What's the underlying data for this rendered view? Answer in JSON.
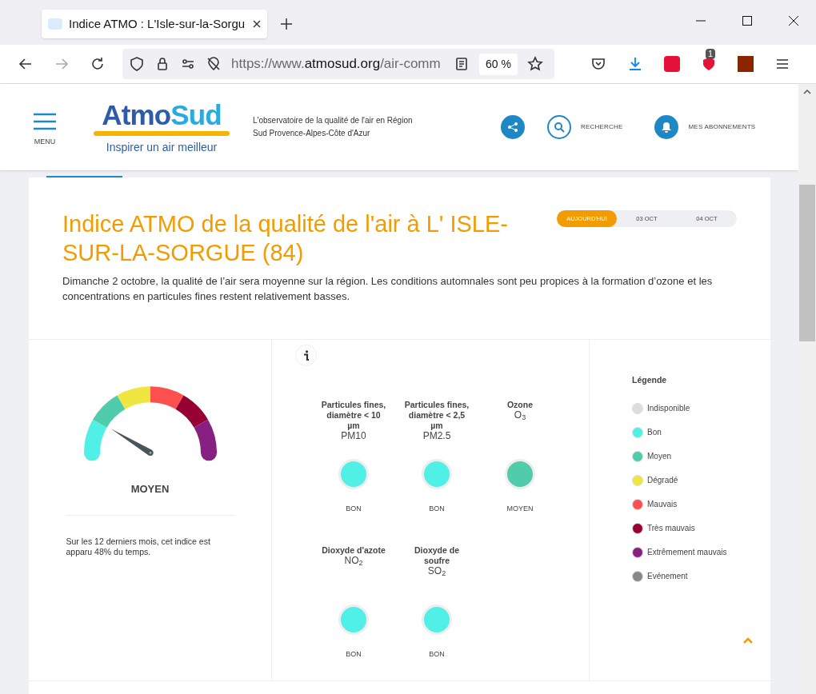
{
  "browser": {
    "tab_title": "Indice ATMO : L'Isle-sur-la-Sorgu",
    "url_prefix": "https://www.",
    "url_domain": "atmosud.org",
    "url_path": "/air-comm",
    "zoom": "60 %",
    "extension_badge": "1"
  },
  "header": {
    "menu_label": "MENU",
    "logo_title_1": "Atmo",
    "logo_title_2": "Sud",
    "logo_tagline": "Inspirer un air meilleur",
    "description": "L'observatoire de la qualité de l'air en Région Sud Provence-Alpes-Côte d'Azur",
    "search_label": "RECHERCHE",
    "subscriptions_label": "MES ABONNEMENTS"
  },
  "title": "Indice ATMO de la qualité de l'air à L' ISLE-SUR-LA-SORGUE (84)",
  "date_tabs": [
    {
      "label": "AUJOURD'HUI",
      "selected": true
    },
    {
      "label": "03 OCT",
      "selected": false
    },
    {
      "label": "04 OCT",
      "selected": false
    }
  ],
  "summary": "Dimanche 2 octobre, la qualité de l’air sera moyenne sur la région. Les conditions automnales sont peu propices à la formation d’ozone et les concentrations en particules fines restent relativement basses.",
  "gauge": {
    "label": "MOYEN",
    "note": "Sur les 12 derniers mois, cet indice est apparu 48% du temps."
  },
  "pollutants": [
    {
      "name": "Particules fines, diamètre < 10 µm",
      "formula": "PM10",
      "status": "BON",
      "color": "#50f0e6"
    },
    {
      "name": "Particules fines, diamètre < 2,5 µm",
      "formula": "PM2.5",
      "status": "BON",
      "color": "#50f0e6"
    },
    {
      "name": "Ozone",
      "formula": "O$_{3}$",
      "status": "MOYEN",
      "color": "#50ccaa"
    },
    {
      "name": "Dioxyde d'azote",
      "formula": "NO$_{2}$",
      "status": "BON",
      "color": "#50f0e6"
    },
    {
      "name": "Dioxyde de soufre",
      "formula": "SO$_{2}$",
      "status": "BON",
      "color": "#50f0e6"
    }
  ],
  "legend": {
    "title": "Légende",
    "items": [
      {
        "label": "Indisponible",
        "color": "#dddddd"
      },
      {
        "label": "Bon",
        "color": "#50f0e6"
      },
      {
        "label": "Moyen",
        "color": "#50ccaa"
      },
      {
        "label": "Dégradé",
        "color": "#f0e641"
      },
      {
        "label": "Mauvais",
        "color": "#ff5050"
      },
      {
        "label": "Très mauvais",
        "color": "#960032"
      },
      {
        "label": "Extrêmement mauvais",
        "color": "#872181"
      },
      {
        "label": "Evénement",
        "color": "#888888"
      }
    ]
  }
}
